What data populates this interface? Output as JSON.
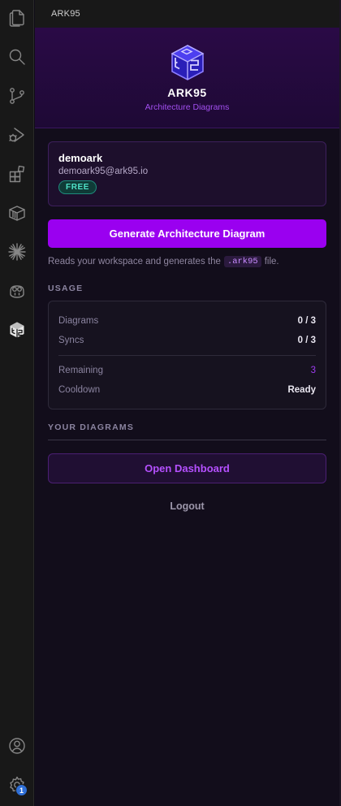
{
  "activity_bar": {
    "items": [
      {
        "icon": "explorer-files-icon"
      },
      {
        "icon": "search-icon"
      },
      {
        "icon": "source-control-icon"
      },
      {
        "icon": "run-debug-icon"
      },
      {
        "icon": "extensions-icon"
      },
      {
        "icon": "package-box-icon"
      },
      {
        "icon": "starburst-icon"
      },
      {
        "icon": "copilot-icon"
      },
      {
        "icon": "ark95-cube-icon"
      }
    ],
    "bottom": {
      "account_icon": "account-icon",
      "settings_icon": "gear-icon",
      "settings_badge": "1"
    }
  },
  "sidebar": {
    "header_title": "ARK95",
    "hero": {
      "title": "ARK95",
      "subtitle": "Architecture Diagrams",
      "logo_icon": "ark95-logo"
    },
    "user": {
      "name": "demoark",
      "email": "demoark95@ark95.io",
      "plan": "FREE"
    },
    "generate_button": "Generate Architecture Diagram",
    "hint": {
      "before": "Reads your workspace and generates the",
      "code": ".ark95",
      "after": "file."
    },
    "usage": {
      "title": "USAGE",
      "rows": [
        {
          "label": "Diagrams",
          "value": "0 / 3"
        },
        {
          "label": "Syncs",
          "value": "0 / 3"
        },
        {
          "label": "Remaining",
          "value": "3"
        },
        {
          "label": "Cooldown",
          "value": "Ready"
        }
      ]
    },
    "diagrams_title": "YOUR DIAGRAMS",
    "dashboard_button": "Open Dashboard",
    "logout": "Logout"
  },
  "colors": {
    "accent": "#9a00f0",
    "hero_bg": "#2a0a46",
    "plan_badge": "#4fe3c8",
    "remaining_value": "#9d3cf0"
  }
}
